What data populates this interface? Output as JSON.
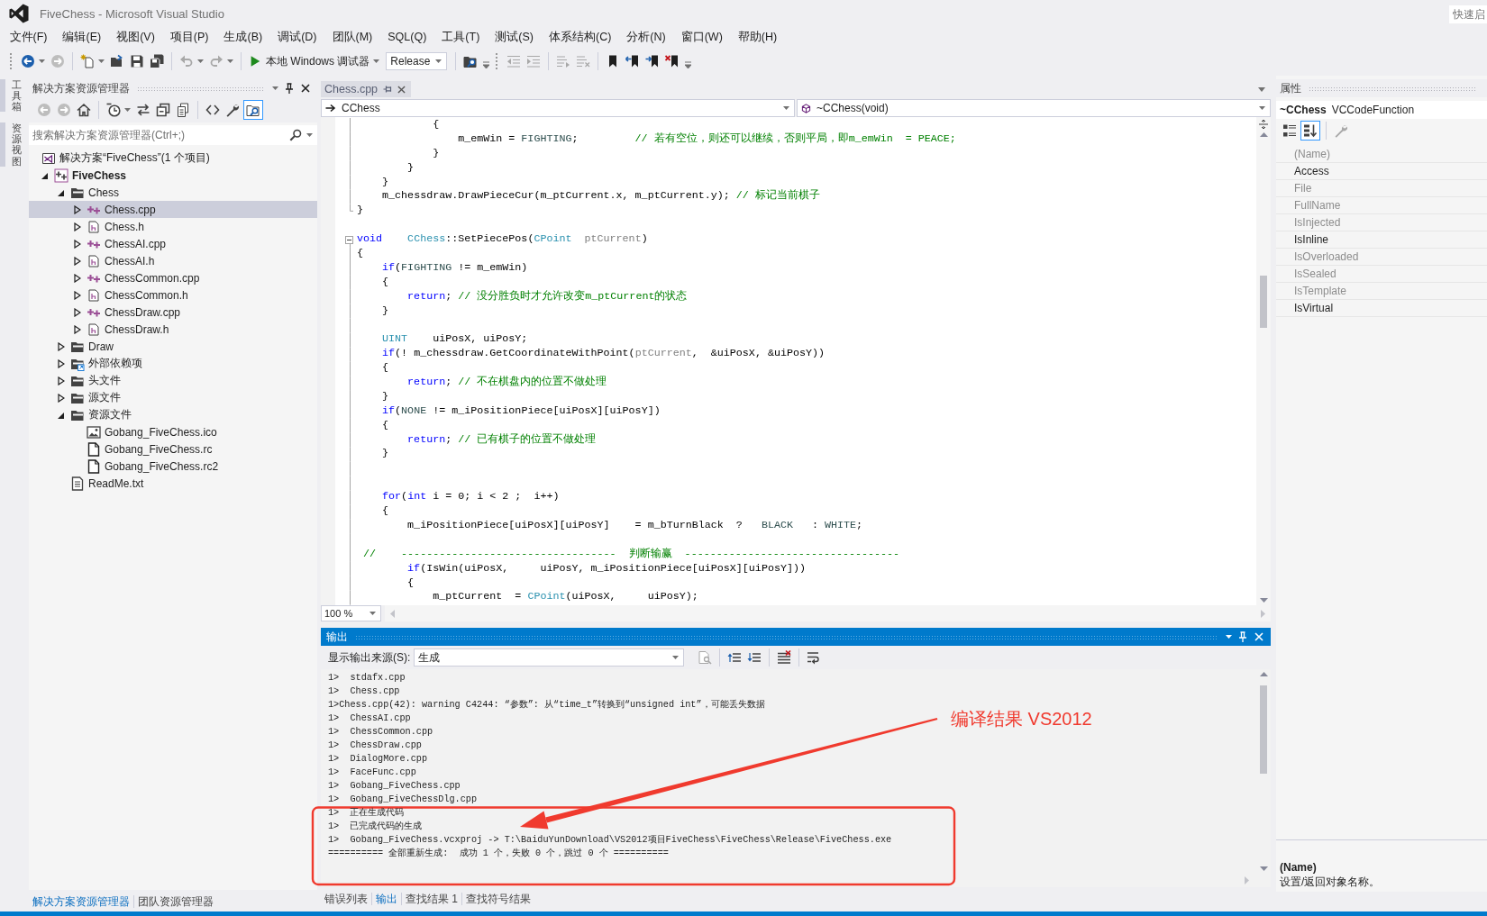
{
  "window": {
    "title": "FiveChess - Microsoft Visual Studio",
    "quick_launch": {
      "placeholder": "快速启"
    }
  },
  "menu": [
    "文件(F)",
    "编辑(E)",
    "视图(V)",
    "项目(P)",
    "生成(B)",
    "调试(D)",
    "团队(M)",
    "SQL(Q)",
    "工具(T)",
    "测试(S)",
    "体系结构(C)",
    "分析(N)",
    "窗口(W)",
    "帮助(H)"
  ],
  "toolbars": [
    {
      "groups": [
        [
          {
            "kind": "back",
            "disabled": false,
            "dropdown": true
          },
          {
            "kind": "forward",
            "disabled": true
          }
        ],
        [
          {
            "kind": "new-project",
            "disabled": false,
            "dropdown": true
          },
          {
            "kind": "open",
            "disabled": false
          },
          {
            "kind": "save",
            "disabled": false
          },
          {
            "kind": "save-all",
            "disabled": false
          }
        ],
        [
          {
            "kind": "undo",
            "disabled": true,
            "dropdown": true
          },
          {
            "kind": "redo",
            "disabled": true,
            "dropdown": true
          }
        ],
        [
          {
            "kind": "start",
            "label": "本地 Windows 调试器",
            "disabled": false,
            "dropdown": true
          },
          {
            "kind": "combo",
            "label": "Release",
            "disabled": false
          }
        ],
        [
          {
            "kind": "find",
            "disabled": false
          }
        ]
      ]
    },
    {
      "groups": [
        [
          {
            "kind": "outdent",
            "disabled": true
          },
          {
            "kind": "indent",
            "disabled": true
          }
        ],
        [
          {
            "kind": "comment",
            "disabled": true
          },
          {
            "kind": "uncomment",
            "disabled": true
          }
        ],
        [
          {
            "kind": "bookmark",
            "disabled": false
          },
          {
            "kind": "bookmark-prev",
            "disabled": false
          },
          {
            "kind": "bookmark-next",
            "disabled": false
          },
          {
            "kind": "bookmark-clear",
            "disabled": false
          }
        ]
      ]
    }
  ],
  "side_tabs": [
    {
      "label": "工具箱"
    },
    {
      "label": "资源视图"
    }
  ],
  "solution_explorer": {
    "title": "解决方案资源管理器",
    "toolbar": [
      [
        {
          "kind": "back",
          "disabled": true,
          "pressed": false
        },
        {
          "kind": "forward",
          "disabled": true,
          "pressed": false
        },
        {
          "kind": "home",
          "disabled": false,
          "pressed": false
        }
      ],
      [
        {
          "kind": "clock",
          "disabled": false,
          "pressed": false,
          "dropdown": true
        },
        {
          "kind": "sync",
          "disabled": false,
          "pressed": false
        },
        {
          "kind": "collapse",
          "disabled": false,
          "pressed": false
        },
        {
          "kind": "show-all",
          "disabled": false,
          "pressed": false
        }
      ],
      [
        {
          "kind": "code",
          "disabled": false,
          "pressed": false
        },
        {
          "kind": "wrench",
          "disabled": false,
          "pressed": false
        },
        {
          "kind": "preview",
          "disabled": false,
          "pressed": true
        }
      ]
    ],
    "search": {
      "placeholder": "搜索解决方案资源管理器(Ctrl+;)"
    },
    "tree": [
      {
        "label": "解决方案“FiveChess”(1 个项目)",
        "kind": "solution",
        "selected": false,
        "children": [
          {
            "label": "FiveChess",
            "kind": "project",
            "expanded": true,
            "selected": false,
            "children": [
              {
                "label": "Chess",
                "kind": "filter",
                "expanded": true,
                "selected": false,
                "children": [
                  {
                    "label": "Chess.cpp",
                    "kind": "cpp",
                    "expanded": false,
                    "selected": true
                  },
                  {
                    "label": "Chess.h",
                    "kind": "header",
                    "expanded": false,
                    "selected": false
                  },
                  {
                    "label": "ChessAI.cpp",
                    "kind": "cpp",
                    "expanded": false,
                    "selected": false
                  },
                  {
                    "label": "ChessAI.h",
                    "kind": "header",
                    "expanded": false,
                    "selected": false
                  },
                  {
                    "label": "ChessCommon.cpp",
                    "kind": "cpp",
                    "expanded": false,
                    "selected": false
                  },
                  {
                    "label": "ChessCommon.h",
                    "kind": "header",
                    "expanded": false,
                    "selected": false
                  },
                  {
                    "label": "ChessDraw.cpp",
                    "kind": "cpp",
                    "expanded": false,
                    "selected": false
                  },
                  {
                    "label": "ChessDraw.h",
                    "kind": "header",
                    "expanded": false,
                    "selected": false
                  }
                ]
              },
              {
                "label": "Draw",
                "kind": "filter",
                "expanded": false,
                "selected": false
              },
              {
                "label": "外部依赖项",
                "kind": "external",
                "expanded": false,
                "selected": false
              },
              {
                "label": "头文件",
                "kind": "filter",
                "expanded": false,
                "selected": false
              },
              {
                "label": "源文件",
                "kind": "filter",
                "expanded": false,
                "selected": false
              },
              {
                "label": "资源文件",
                "kind": "filter",
                "expanded": true,
                "selected": false,
                "children": [
                  {
                    "label": "Gobang_FiveChess.ico",
                    "kind": "image",
                    "selected": false
                  },
                  {
                    "label": "Gobang_FiveChess.rc",
                    "kind": "resource",
                    "selected": false
                  },
                  {
                    "label": "Gobang_FiveChess.rc2",
                    "kind": "resource",
                    "selected": false
                  }
                ]
              },
              {
                "label": "ReadMe.txt",
                "kind": "text",
                "selected": false
              }
            ]
          }
        ]
      }
    ]
  },
  "left_tabs": [
    {
      "label": "解决方案资源管理器",
      "selected": true
    },
    {
      "label": "团队资源管理器",
      "selected": false
    }
  ],
  "editor": {
    "tabs": [
      {
        "label": "Chess.cpp",
        "selected": true
      }
    ],
    "scope": "CChess",
    "member": "~CChess(void)",
    "lines": [
      {
        "kind": "body",
        "tokens": [
          {
            "text": "            {",
            "kind": "plain"
          }
        ]
      },
      {
        "kind": "body",
        "tokens": [
          {
            "text": "                m_emWin = ",
            "kind": "plain"
          },
          {
            "text": "FIGHTING",
            "kind": "enum"
          },
          {
            "text": ";         ",
            "kind": "plain"
          },
          {
            "text": "// 若有空位，则还可以继续，否则平局，即m_emWin  = PEACE;",
            "kind": "comment"
          }
        ]
      },
      {
        "kind": "body",
        "tokens": [
          {
            "text": "            }",
            "kind": "plain"
          }
        ]
      },
      {
        "kind": "body",
        "tokens": [
          {
            "text": "        }",
            "kind": "plain"
          }
        ]
      },
      {
        "kind": "body",
        "tokens": [
          {
            "text": "    }",
            "kind": "plain"
          }
        ]
      },
      {
        "kind": "body",
        "tokens": [
          {
            "text": "    m_chessdraw.DrawPieceCur(m_ptCurrent.x, m_ptCurrent.y); ",
            "kind": "plain"
          },
          {
            "text": "// 标记当前棋子",
            "kind": "comment"
          }
        ]
      },
      {
        "kind": "end",
        "tokens": [
          {
            "text": "}",
            "kind": "plain"
          }
        ]
      },
      {
        "kind": "gap"
      },
      {
        "kind": "start",
        "tokens": [
          {
            "text": "void",
            "kind": "keyword"
          },
          {
            "text": "    CChess",
            "kind": "type"
          },
          {
            "text": "::SetPiecePos(",
            "kind": "plain"
          },
          {
            "text": "CPoint",
            "kind": "type"
          },
          {
            "text": "  ptCurrent",
            "kind": "param"
          },
          {
            "text": ")",
            "kind": "plain"
          }
        ]
      },
      {
        "kind": "body",
        "tokens": [
          {
            "text": "{",
            "kind": "plain"
          }
        ]
      },
      {
        "kind": "body",
        "tokens": [
          {
            "text": "    if",
            "kind": "keyword"
          },
          {
            "text": "(",
            "kind": "plain"
          },
          {
            "text": "FIGHTING",
            "kind": "enum"
          },
          {
            "text": " != m_emWin)",
            "kind": "plain"
          }
        ]
      },
      {
        "kind": "body",
        "tokens": [
          {
            "text": "    {",
            "kind": "plain"
          }
        ]
      },
      {
        "kind": "body",
        "tokens": [
          {
            "text": "        return",
            "kind": "keyword"
          },
          {
            "text": "; ",
            "kind": "plain"
          },
          {
            "text": "// 没分胜负时才允许改变m_ptCurrent的状态",
            "kind": "comment"
          }
        ]
      },
      {
        "kind": "body",
        "tokens": [
          {
            "text": "    }",
            "kind": "plain"
          }
        ]
      },
      {
        "kind": "body"
      },
      {
        "kind": "body",
        "tokens": [
          {
            "text": "    UINT",
            "kind": "type"
          },
          {
            "text": "    uiPosX, uiPosY;",
            "kind": "plain"
          }
        ]
      },
      {
        "kind": "body",
        "tokens": [
          {
            "text": "    if",
            "kind": "keyword"
          },
          {
            "text": "(! m_chessdraw.GetCoordinateWithPoint(",
            "kind": "plain"
          },
          {
            "text": "ptCurrent",
            "kind": "param"
          },
          {
            "text": ",  &uiPosX, &uiPosY))",
            "kind": "plain"
          }
        ]
      },
      {
        "kind": "body",
        "tokens": [
          {
            "text": "    {",
            "kind": "plain"
          }
        ]
      },
      {
        "kind": "body",
        "tokens": [
          {
            "text": "        return",
            "kind": "keyword"
          },
          {
            "text": "; ",
            "kind": "plain"
          },
          {
            "text": "// 不在棋盘内的位置不做处理",
            "kind": "comment"
          }
        ]
      },
      {
        "kind": "body",
        "tokens": [
          {
            "text": "    }",
            "kind": "plain"
          }
        ]
      },
      {
        "kind": "body",
        "tokens": [
          {
            "text": "    if",
            "kind": "keyword"
          },
          {
            "text": "(",
            "kind": "plain"
          },
          {
            "text": "NONE",
            "kind": "enum"
          },
          {
            "text": " != m_iPositionPiece[uiPosX][uiPosY])",
            "kind": "plain"
          }
        ]
      },
      {
        "kind": "body",
        "tokens": [
          {
            "text": "    {",
            "kind": "plain"
          }
        ]
      },
      {
        "kind": "body",
        "tokens": [
          {
            "text": "        return",
            "kind": "keyword"
          },
          {
            "text": "; ",
            "kind": "plain"
          },
          {
            "text": "// 已有棋子的位置不做处理",
            "kind": "comment"
          }
        ]
      },
      {
        "kind": "body",
        "tokens": [
          {
            "text": "    }",
            "kind": "plain"
          }
        ]
      },
      {
        "kind": "body"
      },
      {
        "kind": "body"
      },
      {
        "kind": "body",
        "tokens": [
          {
            "text": "    for",
            "kind": "keyword"
          },
          {
            "text": "(",
            "kind": "plain"
          },
          {
            "text": "int",
            "kind": "keyword"
          },
          {
            "text": " i = 0; i < 2 ;  i++)",
            "kind": "plain"
          }
        ]
      },
      {
        "kind": "body",
        "tokens": [
          {
            "text": "    {",
            "kind": "plain"
          }
        ]
      },
      {
        "kind": "body",
        "tokens": [
          {
            "text": "        m_iPositionPiece[uiPosX][uiPosY]    = m_bTurnBlack  ?   ",
            "kind": "plain"
          },
          {
            "text": "BLACK",
            "kind": "enum"
          },
          {
            "text": "   : ",
            "kind": "plain"
          },
          {
            "text": "WHITE",
            "kind": "enum"
          },
          {
            "text": ";",
            "kind": "plain"
          }
        ]
      },
      {
        "kind": "body"
      },
      {
        "kind": "body",
        "tokens": [
          {
            "text": " //    ----------------------------------  判断输赢  ----------------------------------",
            "kind": "comment"
          }
        ]
      },
      {
        "kind": "body",
        "tokens": [
          {
            "text": "        if",
            "kind": "keyword"
          },
          {
            "text": "(IsWin(uiPosX,     uiPosY, m_iPositionPiece[uiPosX][uiPosY]))",
            "kind": "plain"
          }
        ]
      },
      {
        "kind": "body",
        "tokens": [
          {
            "text": "        {",
            "kind": "plain"
          }
        ]
      },
      {
        "kind": "body",
        "tokens": [
          {
            "text": "            m_ptCurrent  = ",
            "kind": "plain"
          },
          {
            "text": "CPoint",
            "kind": "type"
          },
          {
            "text": "(uiPosX,     uiPosY);",
            "kind": "plain"
          }
        ]
      }
    ],
    "zoom": "100 %"
  },
  "output": {
    "title": "输出",
    "source_label": "显示输出来源(S):",
    "source": "生成",
    "toolbar": [
      [
        {
          "kind": "find-message",
          "disabled": true
        }
      ],
      [
        {
          "kind": "prev-message",
          "disabled": false
        },
        {
          "kind": "next-message",
          "disabled": false
        }
      ],
      [
        {
          "kind": "clear",
          "disabled": false
        }
      ],
      [
        {
          "kind": "wrap",
          "disabled": false
        }
      ]
    ],
    "lines": [
      "1>  stdafx.cpp",
      "1>  Chess.cpp",
      "1>Chess.cpp(42): warning C4244: “参数”: 从“time_t”转换到“unsigned int”，可能丢失数据",
      "1>  ChessAI.cpp",
      "1>  ChessCommon.cpp",
      "1>  ChessDraw.cpp",
      "1>  DialogMore.cpp",
      "1>  FaceFunc.cpp",
      "1>  Gobang_FiveChess.cpp",
      "1>  Gobang_FiveChessDlg.cpp",
      "1>  正在生成代码",
      "1>  已完成代码的生成",
      "1>  Gobang_FiveChess.vcxproj -> T:\\BaiduYunDownload\\VS2012项目FiveChess\\FiveChess\\Release\\FiveChess.exe",
      "========== 全部重新生成:  成功 1 个，失败 0 个，跳过 0 个 =========="
    ]
  },
  "bottom_tabs": [
    {
      "label": "错误列表",
      "selected": false
    },
    {
      "label": "输出",
      "selected": true
    },
    {
      "label": "查找结果 1",
      "selected": false
    },
    {
      "label": "查找符号结果",
      "selected": false
    }
  ],
  "properties": {
    "title": "属性",
    "object_name": "~CChess",
    "object_type": "VCCodeFunction",
    "toolbar": [
      [
        {
          "kind": "categorized",
          "disabled": false,
          "pressed": false
        },
        {
          "kind": "alphabetical",
          "disabled": false,
          "pressed": true
        }
      ],
      [
        {
          "kind": "wrench",
          "disabled": true,
          "pressed": false
        }
      ]
    ],
    "rows": [
      {
        "name": "(Name)",
        "disabled": true
      },
      {
        "name": "Access",
        "disabled": false
      },
      {
        "name": "File",
        "disabled": true
      },
      {
        "name": "FullName",
        "disabled": true
      },
      {
        "name": "IsInjected",
        "disabled": true
      },
      {
        "name": "IsInline",
        "disabled": false
      },
      {
        "name": "IsOverloaded",
        "disabled": true
      },
      {
        "name": "IsSealed",
        "disabled": true
      },
      {
        "name": "IsTemplate",
        "disabled": true
      },
      {
        "name": "IsVirtual",
        "disabled": false
      }
    ],
    "description": {
      "title": "(Name)",
      "text": "设置/返回对象名称。"
    }
  },
  "annotation": {
    "text": "编译结果 VS2012"
  }
}
